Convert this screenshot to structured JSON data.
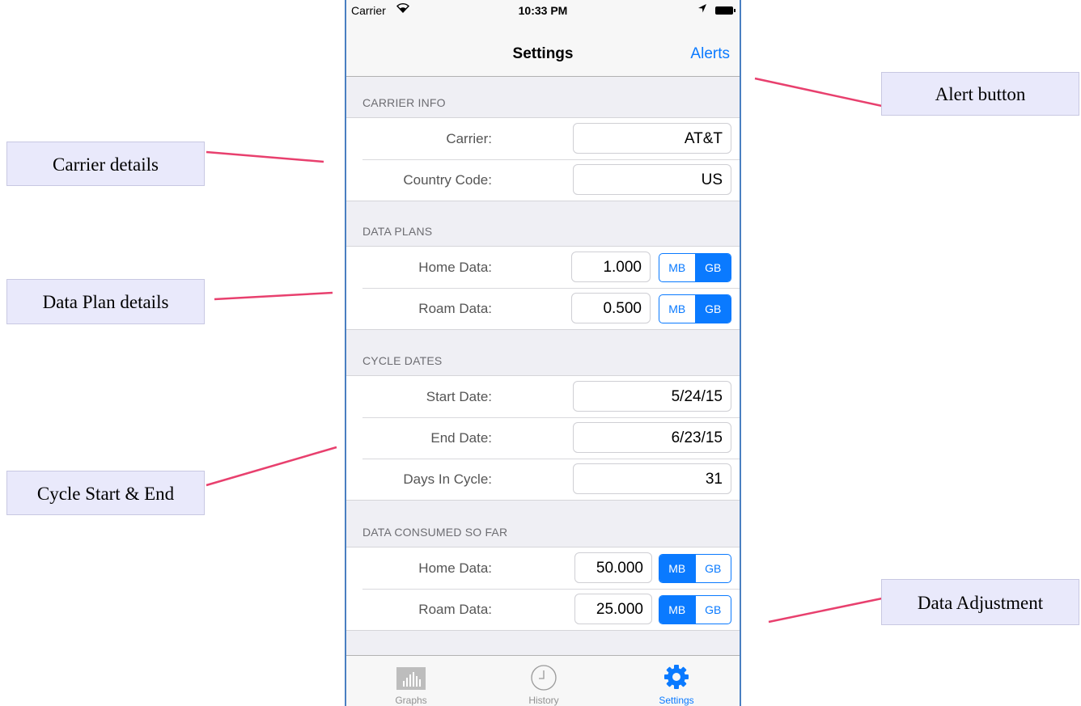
{
  "status_bar": {
    "carrier": "Carrier",
    "time": "10:33 PM"
  },
  "nav": {
    "title": "Settings",
    "alerts_label": "Alerts"
  },
  "sections": {
    "carrier_info": {
      "header": "CARRIER INFO",
      "rows": [
        {
          "label": "Carrier:",
          "value": "AT&T"
        },
        {
          "label": "Country Code:",
          "value": "US"
        }
      ]
    },
    "data_plans": {
      "header": "DATA PLANS",
      "rows": [
        {
          "label": "Home Data:",
          "value": "1.000",
          "unit_options": [
            "MB",
            "GB"
          ],
          "selected_unit": "GB"
        },
        {
          "label": "Roam Data:",
          "value": "0.500",
          "unit_options": [
            "MB",
            "GB"
          ],
          "selected_unit": "GB"
        }
      ]
    },
    "cycle_dates": {
      "header": "CYCLE DATES",
      "rows": [
        {
          "label": "Start Date:",
          "value": "5/24/15"
        },
        {
          "label": "End Date:",
          "value": "6/23/15"
        },
        {
          "label": "Days In Cycle:",
          "value": "31"
        }
      ]
    },
    "data_consumed": {
      "header": "DATA CONSUMED SO FAR",
      "rows": [
        {
          "label": "Home Data:",
          "value": "50.000",
          "unit_options": [
            "MB",
            "GB"
          ],
          "selected_unit": "MB"
        },
        {
          "label": "Roam Data:",
          "value": "25.000",
          "unit_options": [
            "MB",
            "GB"
          ],
          "selected_unit": "MB"
        }
      ]
    }
  },
  "tab_bar": {
    "tabs": [
      {
        "label": "Graphs",
        "icon": "bar-chart-icon",
        "active": false
      },
      {
        "label": "History",
        "icon": "clock-icon",
        "active": false
      },
      {
        "label": "Settings",
        "icon": "gear-icon",
        "active": true
      }
    ]
  },
  "callouts": {
    "alert_button": "Alert button",
    "carrier_details": "Carrier details",
    "data_plan_details": "Data Plan details",
    "cycle_start_end": "Cycle Start & End",
    "data_adjustment": "Data Adjustment"
  },
  "colors": {
    "accent": "#0a7aff",
    "callout_line": "#e8406e",
    "callout_fill": "#e9e9fb",
    "phone_border": "#4a7fc1"
  }
}
